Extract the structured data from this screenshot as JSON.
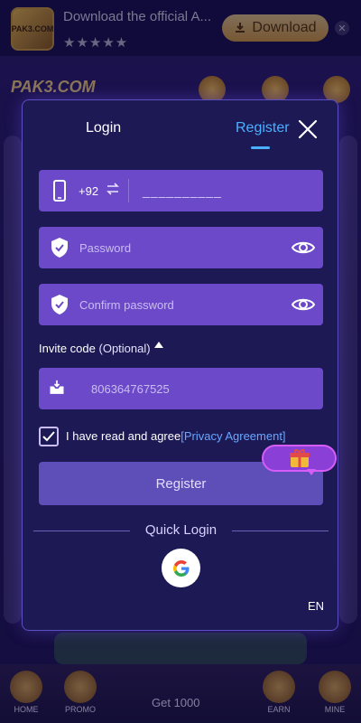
{
  "banner": {
    "logo_text": "PAK3.COM",
    "text": "Download the official A...",
    "rating": "★★★★★",
    "download_label": "Download"
  },
  "topbar": {
    "brand": "PAK3.COM"
  },
  "bottom_nav": {
    "items": [
      {
        "label": "HOME"
      },
      {
        "label": "PROMO"
      },
      {
        "label": "EARN"
      },
      {
        "label": "MINE"
      }
    ],
    "get_label": "Get 1000"
  },
  "modal": {
    "tabs": [
      {
        "label": "Login",
        "active": false
      },
      {
        "label": "Register",
        "active": true
      }
    ],
    "phone": {
      "country_code": "+92",
      "placeholder": "__________"
    },
    "password": {
      "placeholder": "Password"
    },
    "confirm_password": {
      "placeholder": "Confirm password"
    },
    "invite": {
      "label": "Invite code",
      "optional": "(Optional)",
      "value": "806364767525"
    },
    "agreement": {
      "checked": true,
      "text": "I have read and agree",
      "link": "[Privacy Agreement]"
    },
    "register_button": "Register",
    "quick_login": "Quick Login",
    "language": "EN"
  },
  "colors": {
    "modal_bg": "#1c1954",
    "field_bg": "#6b49c8",
    "accent_blue": "#4ab0ff",
    "register_btn": "#5e4fb8"
  },
  "icons": [
    "phone-icon",
    "swap-icon",
    "shield-check-icon",
    "eye-icon",
    "inbox-icon",
    "close-icon",
    "google-icon",
    "gift-icon",
    "checkmark-icon"
  ]
}
